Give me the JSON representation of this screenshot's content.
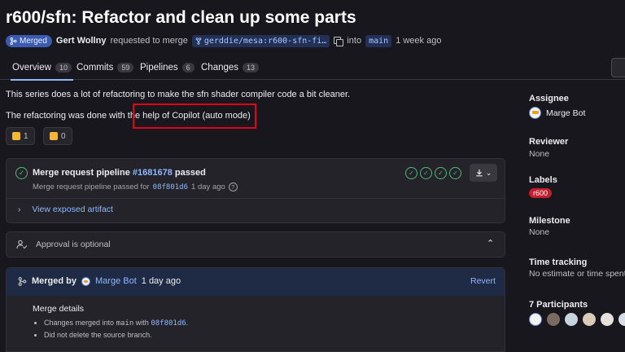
{
  "header": {
    "title": "r600/sfn: Refactor and clean up some parts",
    "status_badge": "Merged",
    "author": "Gert Wollny",
    "requested_text": "requested to merge",
    "source_branch": "gerddie/mesa:r600-sfn-fi…",
    "into_text": "into",
    "target_branch": "main",
    "time_ago": "1 week ago"
  },
  "tabs": [
    {
      "label": "Overview",
      "count": "10"
    },
    {
      "label": "Commits",
      "count": "59"
    },
    {
      "label": "Pipelines",
      "count": "6"
    },
    {
      "label": "Changes",
      "count": "13"
    }
  ],
  "description": {
    "line1": "This series does a lot of refactoring to make the sfn shader compiler code a bit cleaner.",
    "line2": "The refactoring was done with the help of Copilot (auto mode)"
  },
  "reactions": {
    "thumbs_up": "1",
    "thumbs_down": "0"
  },
  "pipeline": {
    "title_prefix": "Merge request pipeline",
    "id": "#1681678",
    "status": "passed",
    "sub_prefix": "Merge request pipeline passed for",
    "sha": "08f801d6",
    "sub_time": "1 day ago",
    "artifact_link": "View exposed artifact"
  },
  "approval": {
    "text": "Approval is optional"
  },
  "merged": {
    "prefix": "Merged by",
    "by": "Marge Bot",
    "time": "1 day ago",
    "revert": "Revert",
    "details_title": "Merge details",
    "detail_1_prefix": "Changes merged into",
    "detail_1_branch": "main",
    "detail_1_with": "with",
    "detail_1_sha": "08f801d6",
    "detail_2": "Did not delete the source branch."
  },
  "sidebar": {
    "assignee_label": "Assignee",
    "assignee": "Marge Bot",
    "reviewer_label": "Reviewer",
    "reviewer": "None",
    "labels_label": "Labels",
    "label_chip": "r600",
    "milestone_label": "Milestone",
    "milestone": "None",
    "time_label": "Time tracking",
    "time_value": "No estimate or time spent",
    "participants_label": "7 Participants"
  },
  "colors": {
    "background": "#18171d",
    "accent_link": "#8fb8ff",
    "success": "#52b87a",
    "merged_badge": "#3a5bb0",
    "highlight_box": "#e0001a",
    "label_chip": "#c21e2d"
  }
}
